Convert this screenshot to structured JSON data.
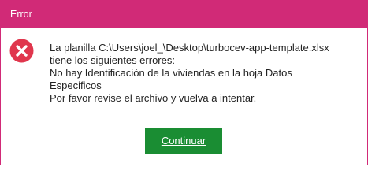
{
  "window": {
    "title": "Error"
  },
  "icon": {
    "name": "error-circle-x-icon",
    "color": "#e0364d"
  },
  "message": {
    "lines": [
      "La planilla C:\\Users\\joel_\\Desktop\\turbocev-app-template.xlsx",
      "tiene los siguientes errores:",
      "No hay Identificación de la viviendas en la hoja Datos",
      "Especificos",
      "Por favor revise el archivo y vuelva a intentar."
    ]
  },
  "buttons": {
    "continue_label": "Continuar"
  },
  "colors": {
    "titlebar": "#d12a77",
    "button": "#1a8d33"
  }
}
